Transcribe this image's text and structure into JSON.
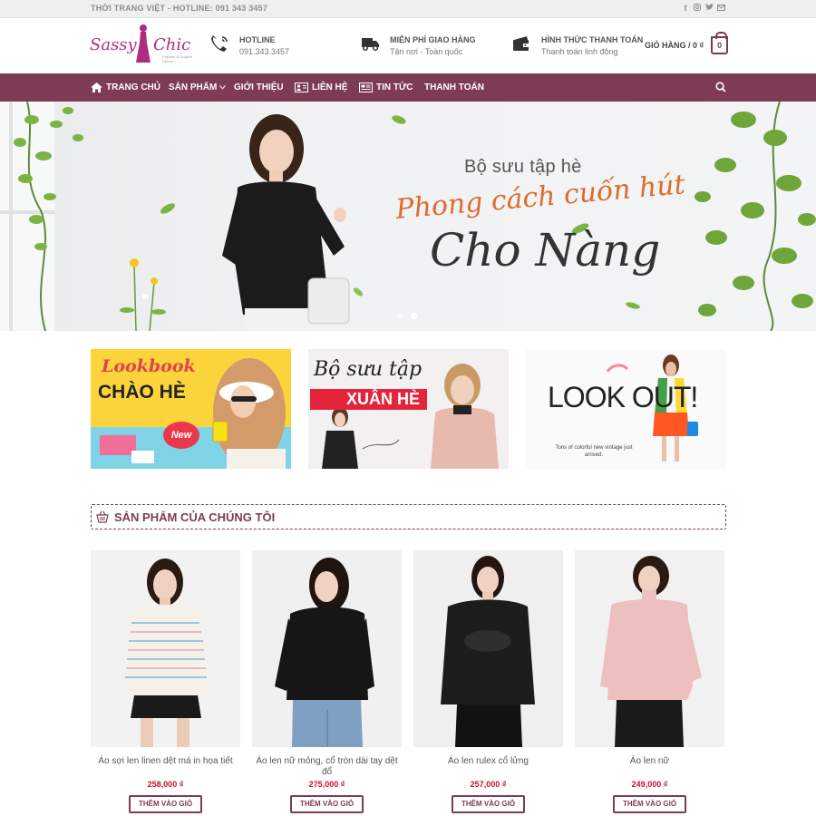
{
  "topbar": {
    "text": "THỜI TRANG VIỆT - HOTLINE: 091 343 3457",
    "social": [
      "facebook-icon",
      "instagram-icon",
      "twitter-icon",
      "mail-icon"
    ]
  },
  "header": {
    "logo_main": "Sassy",
    "logo_second": "Chic",
    "logo_sub": "Fashion & Lingerie Deluxe",
    "info": [
      {
        "icon": "phone-icon",
        "title": "HOTLINE",
        "sub": "091.343.3457"
      },
      {
        "icon": "truck-icon",
        "title": "MIỄN PHÍ GIAO HÀNG",
        "sub": "Tận nơi - Toàn quốc"
      },
      {
        "icon": "payment-icon",
        "title": "HÌNH THỨC THANH TOÁN",
        "sub": "Thanh toán linh động"
      }
    ],
    "cart_label": "GIỎ HÀNG / 0 ₫",
    "cart_count": "0"
  },
  "nav": {
    "items": [
      "TRANG CHỦ",
      "SẢN PHẨM",
      "GIỚI THIỆU",
      "LIÊN HỆ",
      "TIN TỨC",
      "THANH TOÁN"
    ]
  },
  "hero": {
    "line1": "Bộ sưu tập hè",
    "line2": "Phong cách cuốn hút",
    "line3": "Cho Nàng"
  },
  "promos": {
    "p1_title": "Lookbook",
    "p1_sub": "CHÀO HÈ",
    "p1_badge": "New",
    "p2_title": "Bộ sưu tập",
    "p2_sub": "XUÂN HÈ",
    "p3_title": "LOOK OUT!",
    "p3_sub": "Tons of colorful new vintage just arrived."
  },
  "section": {
    "title": "SẢN PHẨM CỦA CHÚNG TÔI"
  },
  "products": [
    {
      "name": "Áo sợi len linen dệt má in họa tiết",
      "price": "258,000 ₫",
      "button": "THÊM VÀO GIỎ"
    },
    {
      "name": "Áo len nữ mỏng, cổ tròn dài tay dệt đổ",
      "price": "275,000 ₫",
      "button": "THÊM VÀO GIỎ"
    },
    {
      "name": "Áo len rulex cổ lửng",
      "price": "257,000 ₫",
      "button": "THÊM VÀO GIỎ"
    },
    {
      "name": "Áo len nữ",
      "price": "249,000 ₫",
      "button": "THÊM VÀO GIỎ"
    }
  ],
  "colors": {
    "brand": "#7d3c54",
    "price": "#c8102e",
    "accent_orange": "#e06a2c",
    "logo": "#b02c7e"
  }
}
